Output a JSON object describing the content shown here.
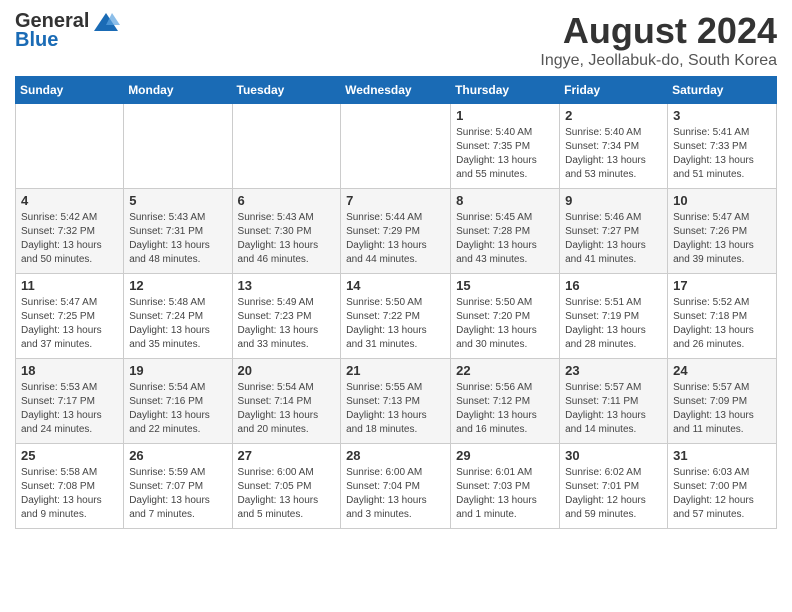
{
  "header": {
    "logo_general": "General",
    "logo_blue": "Blue",
    "month_title": "August 2024",
    "location": "Ingye, Jeollabuk-do, South Korea"
  },
  "days_of_week": [
    "Sunday",
    "Monday",
    "Tuesday",
    "Wednesday",
    "Thursday",
    "Friday",
    "Saturday"
  ],
  "weeks": [
    [
      {
        "day": "",
        "info": ""
      },
      {
        "day": "",
        "info": ""
      },
      {
        "day": "",
        "info": ""
      },
      {
        "day": "",
        "info": ""
      },
      {
        "day": "1",
        "info": "Sunrise: 5:40 AM\nSunset: 7:35 PM\nDaylight: 13 hours\nand 55 minutes."
      },
      {
        "day": "2",
        "info": "Sunrise: 5:40 AM\nSunset: 7:34 PM\nDaylight: 13 hours\nand 53 minutes."
      },
      {
        "day": "3",
        "info": "Sunrise: 5:41 AM\nSunset: 7:33 PM\nDaylight: 13 hours\nand 51 minutes."
      }
    ],
    [
      {
        "day": "4",
        "info": "Sunrise: 5:42 AM\nSunset: 7:32 PM\nDaylight: 13 hours\nand 50 minutes."
      },
      {
        "day": "5",
        "info": "Sunrise: 5:43 AM\nSunset: 7:31 PM\nDaylight: 13 hours\nand 48 minutes."
      },
      {
        "day": "6",
        "info": "Sunrise: 5:43 AM\nSunset: 7:30 PM\nDaylight: 13 hours\nand 46 minutes."
      },
      {
        "day": "7",
        "info": "Sunrise: 5:44 AM\nSunset: 7:29 PM\nDaylight: 13 hours\nand 44 minutes."
      },
      {
        "day": "8",
        "info": "Sunrise: 5:45 AM\nSunset: 7:28 PM\nDaylight: 13 hours\nand 43 minutes."
      },
      {
        "day": "9",
        "info": "Sunrise: 5:46 AM\nSunset: 7:27 PM\nDaylight: 13 hours\nand 41 minutes."
      },
      {
        "day": "10",
        "info": "Sunrise: 5:47 AM\nSunset: 7:26 PM\nDaylight: 13 hours\nand 39 minutes."
      }
    ],
    [
      {
        "day": "11",
        "info": "Sunrise: 5:47 AM\nSunset: 7:25 PM\nDaylight: 13 hours\nand 37 minutes."
      },
      {
        "day": "12",
        "info": "Sunrise: 5:48 AM\nSunset: 7:24 PM\nDaylight: 13 hours\nand 35 minutes."
      },
      {
        "day": "13",
        "info": "Sunrise: 5:49 AM\nSunset: 7:23 PM\nDaylight: 13 hours\nand 33 minutes."
      },
      {
        "day": "14",
        "info": "Sunrise: 5:50 AM\nSunset: 7:22 PM\nDaylight: 13 hours\nand 31 minutes."
      },
      {
        "day": "15",
        "info": "Sunrise: 5:50 AM\nSunset: 7:20 PM\nDaylight: 13 hours\nand 30 minutes."
      },
      {
        "day": "16",
        "info": "Sunrise: 5:51 AM\nSunset: 7:19 PM\nDaylight: 13 hours\nand 28 minutes."
      },
      {
        "day": "17",
        "info": "Sunrise: 5:52 AM\nSunset: 7:18 PM\nDaylight: 13 hours\nand 26 minutes."
      }
    ],
    [
      {
        "day": "18",
        "info": "Sunrise: 5:53 AM\nSunset: 7:17 PM\nDaylight: 13 hours\nand 24 minutes."
      },
      {
        "day": "19",
        "info": "Sunrise: 5:54 AM\nSunset: 7:16 PM\nDaylight: 13 hours\nand 22 minutes."
      },
      {
        "day": "20",
        "info": "Sunrise: 5:54 AM\nSunset: 7:14 PM\nDaylight: 13 hours\nand 20 minutes."
      },
      {
        "day": "21",
        "info": "Sunrise: 5:55 AM\nSunset: 7:13 PM\nDaylight: 13 hours\nand 18 minutes."
      },
      {
        "day": "22",
        "info": "Sunrise: 5:56 AM\nSunset: 7:12 PM\nDaylight: 13 hours\nand 16 minutes."
      },
      {
        "day": "23",
        "info": "Sunrise: 5:57 AM\nSunset: 7:11 PM\nDaylight: 13 hours\nand 14 minutes."
      },
      {
        "day": "24",
        "info": "Sunrise: 5:57 AM\nSunset: 7:09 PM\nDaylight: 13 hours\nand 11 minutes."
      }
    ],
    [
      {
        "day": "25",
        "info": "Sunrise: 5:58 AM\nSunset: 7:08 PM\nDaylight: 13 hours\nand 9 minutes."
      },
      {
        "day": "26",
        "info": "Sunrise: 5:59 AM\nSunset: 7:07 PM\nDaylight: 13 hours\nand 7 minutes."
      },
      {
        "day": "27",
        "info": "Sunrise: 6:00 AM\nSunset: 7:05 PM\nDaylight: 13 hours\nand 5 minutes."
      },
      {
        "day": "28",
        "info": "Sunrise: 6:00 AM\nSunset: 7:04 PM\nDaylight: 13 hours\nand 3 minutes."
      },
      {
        "day": "29",
        "info": "Sunrise: 6:01 AM\nSunset: 7:03 PM\nDaylight: 13 hours\nand 1 minute."
      },
      {
        "day": "30",
        "info": "Sunrise: 6:02 AM\nSunset: 7:01 PM\nDaylight: 12 hours\nand 59 minutes."
      },
      {
        "day": "31",
        "info": "Sunrise: 6:03 AM\nSunset: 7:00 PM\nDaylight: 12 hours\nand 57 minutes."
      }
    ]
  ]
}
